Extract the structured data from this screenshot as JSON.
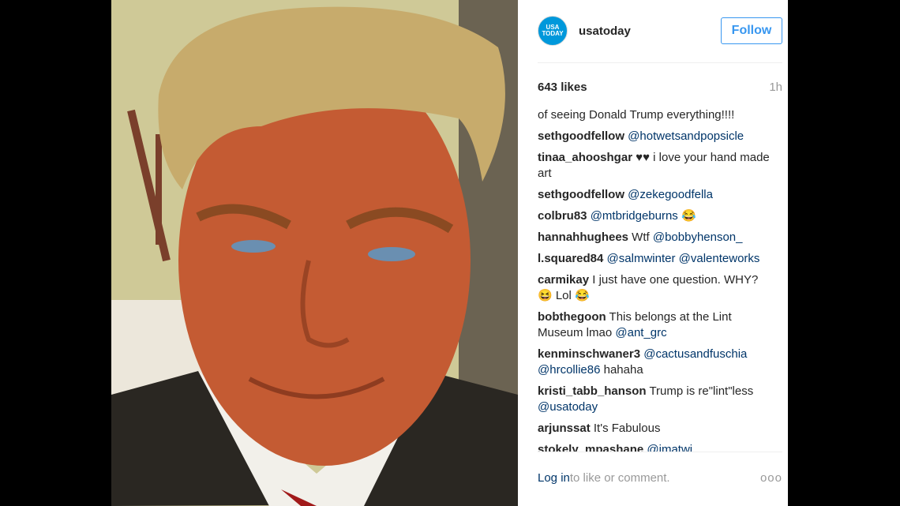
{
  "post": {
    "username": "usatoday",
    "avatar_text": "USA TODAY",
    "follow_label": "Follow",
    "likes": "643 likes",
    "time": "1h"
  },
  "comments": [
    {
      "parts": [
        {
          "t": "text",
          "v": "of seeing Donald Trump everything!!!!"
        }
      ]
    },
    {
      "parts": [
        {
          "t": "user",
          "v": "sethgoodfellow"
        },
        {
          "t": "text",
          "v": " "
        },
        {
          "t": "mention",
          "v": "@hotwetsandpopsicle"
        }
      ]
    },
    {
      "parts": [
        {
          "t": "user",
          "v": "tinaa_ahooshgar"
        },
        {
          "t": "text",
          "v": " ♥♥ i love your hand made art"
        }
      ]
    },
    {
      "parts": [
        {
          "t": "user",
          "v": "sethgoodfellow"
        },
        {
          "t": "text",
          "v": " "
        },
        {
          "t": "mention",
          "v": "@zekegoodfella"
        }
      ]
    },
    {
      "parts": [
        {
          "t": "user",
          "v": "colbru83"
        },
        {
          "t": "text",
          "v": " "
        },
        {
          "t": "mention",
          "v": "@mtbridgeburns"
        },
        {
          "t": "text",
          "v": " 😂"
        }
      ]
    },
    {
      "parts": [
        {
          "t": "user",
          "v": "hannahhughees"
        },
        {
          "t": "text",
          "v": " Wtf "
        },
        {
          "t": "mention",
          "v": "@bobbyhenson_"
        }
      ]
    },
    {
      "parts": [
        {
          "t": "user",
          "v": "l.squared84"
        },
        {
          "t": "text",
          "v": " "
        },
        {
          "t": "mention",
          "v": "@salmwinter"
        },
        {
          "t": "text",
          "v": " "
        },
        {
          "t": "mention",
          "v": "@valenteworks"
        }
      ]
    },
    {
      "parts": [
        {
          "t": "user",
          "v": "carmikay"
        },
        {
          "t": "text",
          "v": " I just have one question. WHY? 😆 Lol 😂"
        }
      ]
    },
    {
      "parts": [
        {
          "t": "user",
          "v": "bobthegoon"
        },
        {
          "t": "text",
          "v": " This belongs at the Lint Museum lmao "
        },
        {
          "t": "mention",
          "v": "@ant_grc"
        }
      ]
    },
    {
      "parts": [
        {
          "t": "user",
          "v": "kenminschwaner3"
        },
        {
          "t": "text",
          "v": " "
        },
        {
          "t": "mention",
          "v": "@cactusandfuschia"
        },
        {
          "t": "text",
          "v": " "
        },
        {
          "t": "mention",
          "v": "@hrcollie86"
        },
        {
          "t": "text",
          "v": " hahaha"
        }
      ]
    },
    {
      "parts": [
        {
          "t": "user",
          "v": "kristi_tabb_hanson"
        },
        {
          "t": "text",
          "v": " Trump is re\"lint\"less "
        },
        {
          "t": "mention",
          "v": "@usatoday"
        }
      ]
    },
    {
      "parts": [
        {
          "t": "user",
          "v": "arjunssat"
        },
        {
          "t": "text",
          "v": " It's Fabulous"
        }
      ]
    },
    {
      "parts": [
        {
          "t": "user",
          "v": "stokely_mpashane"
        },
        {
          "t": "text",
          "v": " "
        },
        {
          "t": "mention",
          "v": "@imatwi"
        }
      ]
    }
  ],
  "footer": {
    "login": "Log in",
    "rest": " to like or comment.",
    "more": "ooo"
  }
}
